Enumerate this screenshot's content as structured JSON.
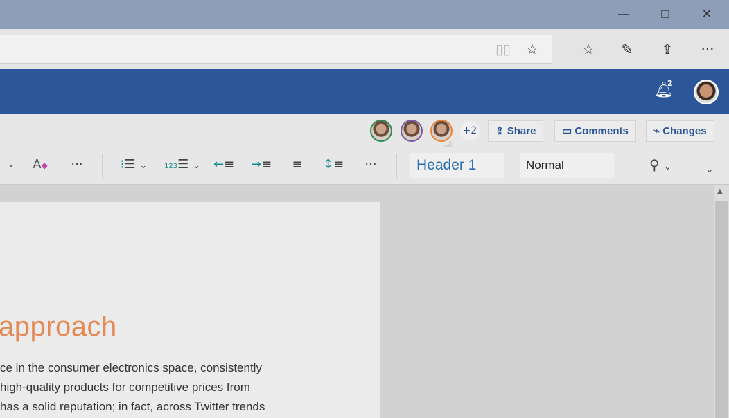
{
  "titlebar": {
    "minimize": "—",
    "restore": "❐",
    "close": "✕"
  },
  "browser": {
    "icons": [
      "reading-view-icon",
      "favorite-star-icon",
      "favorites-list-icon",
      "pen-icon",
      "share-icon",
      "more-icon"
    ],
    "more": "···"
  },
  "ribbon": {
    "notification_count": "2",
    "icons": [
      "bell-icon",
      "user-avatar"
    ]
  },
  "collab": {
    "extra_count": "+2",
    "share": "Share",
    "comments": "Comments",
    "changes": "Changes",
    "avatar_colors": [
      "#2e8b57",
      "#7a5aa6",
      "#e8843a"
    ]
  },
  "toolbar": {
    "more": "···",
    "style_selected": "Header 1",
    "style_normal": "Normal"
  },
  "document": {
    "heading": "approach",
    "lines": [
      "ce in the consumer electronics space, consistently",
      "high-quality products for competitive prices from",
      "has a solid reputation; in fact, across Twitter trends"
    ],
    "heading_color": "#e48a56"
  },
  "colors": {
    "ribbon": "#2b579a",
    "accent_teal": "#168a91"
  }
}
